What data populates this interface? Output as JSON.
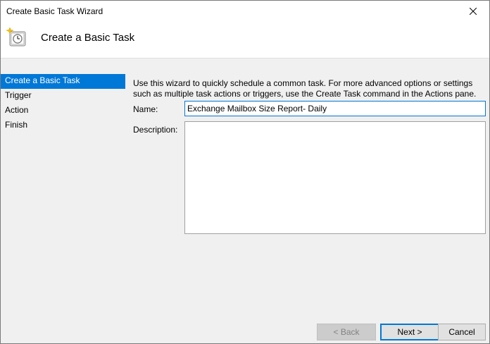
{
  "window": {
    "title": "Create Basic Task Wizard"
  },
  "header": {
    "title": "Create a Basic Task",
    "icon": "task-clock-icon"
  },
  "sidebar": {
    "items": [
      {
        "label": "Create a Basic Task",
        "active": true
      },
      {
        "label": "Trigger",
        "active": false
      },
      {
        "label": "Action",
        "active": false
      },
      {
        "label": "Finish",
        "active": false
      }
    ]
  },
  "main": {
    "intro": "Use this wizard to quickly schedule a common task.  For more advanced options or settings such as multiple task actions or triggers, use the Create Task command in the Actions pane.",
    "name_label": "Name:",
    "name_value": "Exchange Mailbox Size Report- Daily",
    "description_label": "Description:",
    "description_value": ""
  },
  "buttons": {
    "back": "< Back",
    "next": "Next >",
    "cancel": "Cancel"
  },
  "colors": {
    "accent": "#0078d7"
  }
}
